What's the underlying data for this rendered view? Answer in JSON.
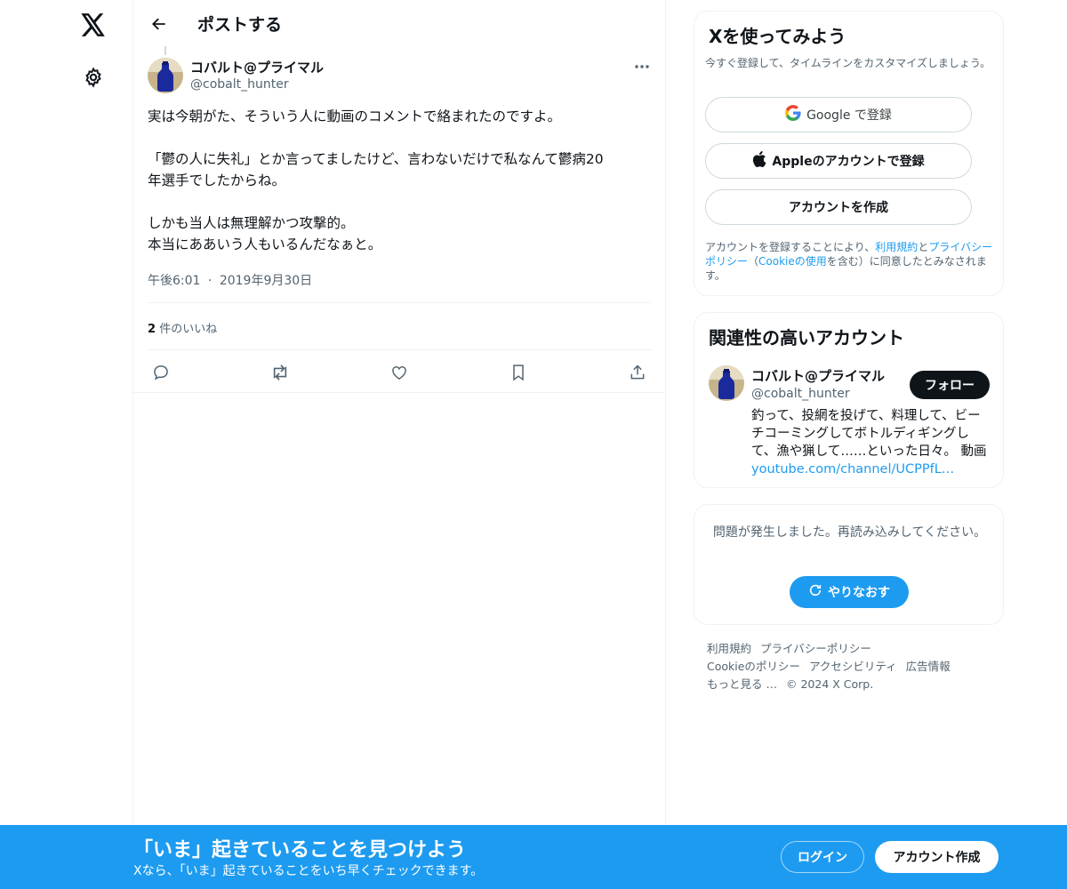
{
  "colors": {
    "accent": "#1d9bf0",
    "text": "#0f1419",
    "muted": "#536471"
  },
  "nav": {
    "logo_icon": "x-logo-icon",
    "settings_icon": "gear-icon"
  },
  "header": {
    "back_icon": "arrow-left-icon",
    "title": "ポストする"
  },
  "post": {
    "author_name": "コバルト@プライマル",
    "author_handle": "@cobalt_hunter",
    "more_icon": "ellipsis-icon",
    "paragraphs": [
      "実は今朝がた、そういう人に動画のコメントで絡まれたのですよ。",
      "「鬱の人に失礼」とか言ってましたけど、言わないだけで私なんて鬱病20\n年選手でしたからね。",
      "しかも当人は無理解かつ攻撃的。\n本当にああいう人もいるんだなぁと。"
    ],
    "time": "午後6:01",
    "separator": "·",
    "date": "2019年9月30日",
    "likes_count": "2",
    "likes_label": "件のいいね",
    "actions": [
      "reply-icon",
      "repost-icon",
      "like-icon",
      "bookmark-icon",
      "share-icon"
    ]
  },
  "signup": {
    "title": "Xを使ってみよう",
    "subtitle": "今すぐ登録して、タイムラインをカスタマイズしましょう。",
    "google_label": "Google で登録",
    "apple_label": "Appleのアカウントで登録",
    "create_label": "アカウントを作成",
    "legal_prefix": "アカウントを登録することにより、",
    "terms_link": "利用規約",
    "legal_and": "と",
    "privacy_link": "プライバシーポリシー",
    "legal_mid": "（",
    "cookie_link": "Cookieの使用",
    "legal_suffix": "を含む）に同意したとみなされます。"
  },
  "related": {
    "title": "関連性の高いアカウント",
    "name": "コバルト@プライマル",
    "handle": "@cobalt_hunter",
    "follow_label": "フォロー",
    "bio": "釣って、投網を投げて、料理して、ビーチコーミングしてボトルディギングして、漁や猟して……といった日々。 動画",
    "bio_link": "youtube.com/channel/UCPPfL…"
  },
  "error": {
    "message": "問題が発生しました。再読み込みしてください。",
    "retry_label": "やりなおす",
    "retry_icon": "refresh-icon"
  },
  "footer": {
    "line1": [
      "利用規約",
      "プライバシーポリシー"
    ],
    "line2": [
      "Cookieのポリシー",
      "アクセシビリティ",
      "広告情報"
    ],
    "more": "もっと見る …",
    "copyright": "© 2024 X Corp."
  },
  "banner": {
    "title": "「いま」起きていることを見つけよう",
    "subtitle": "Xなら、「いま」起きていることをいち早くチェックできます。",
    "login_label": "ログイン",
    "create_label": "アカウント作成"
  }
}
